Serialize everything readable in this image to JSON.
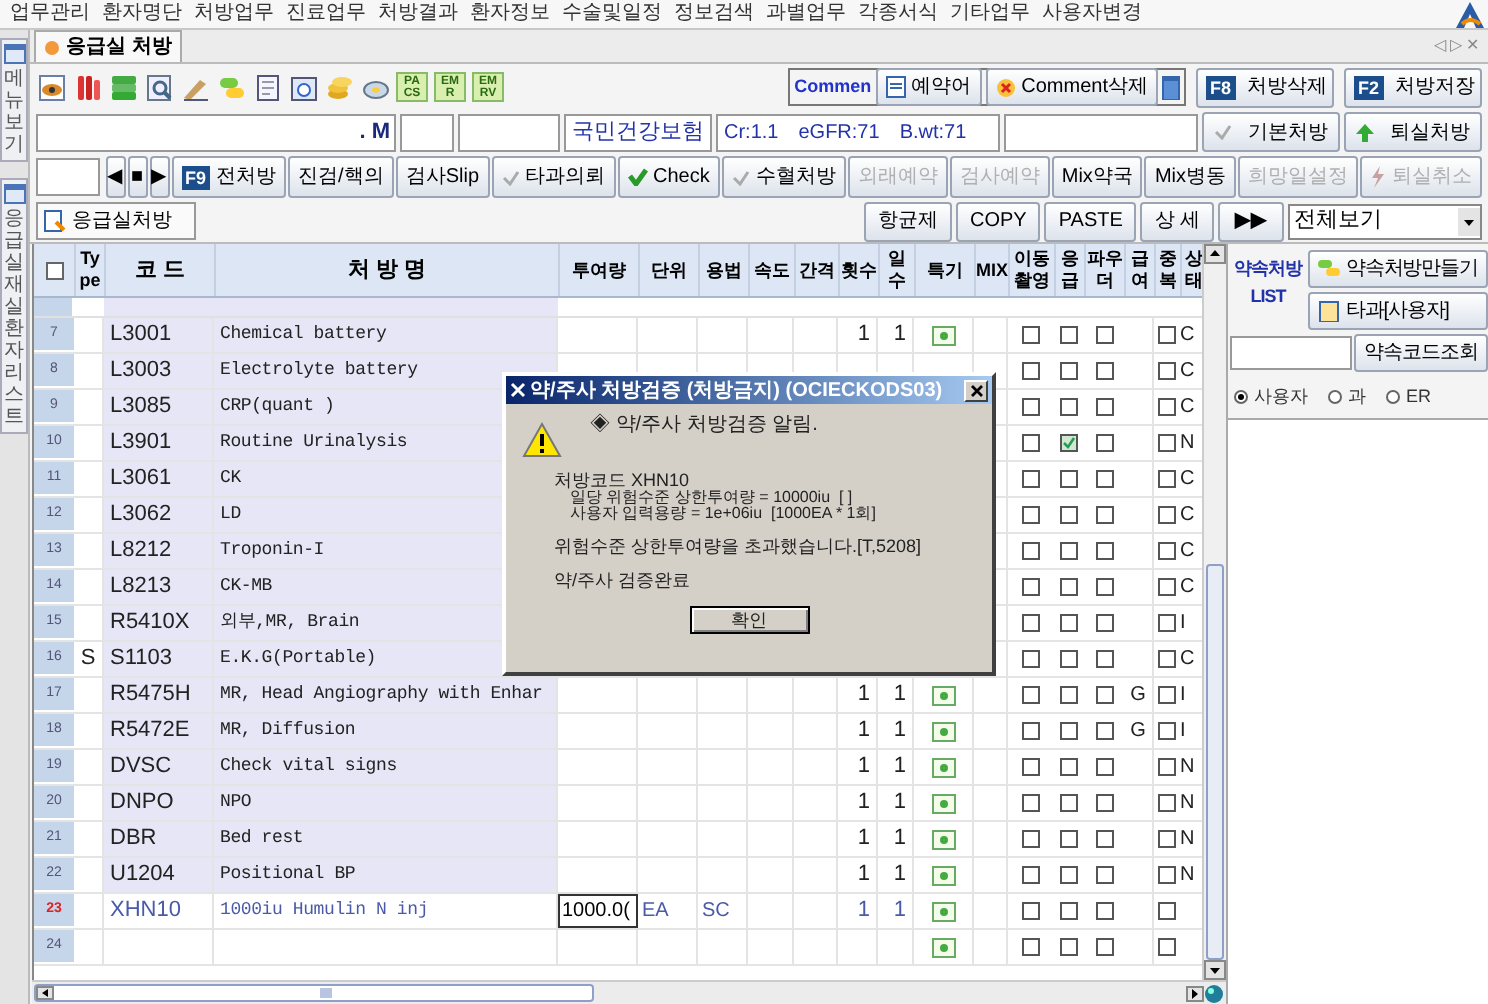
{
  "menu": [
    "업무관리",
    "환자명단",
    "처방업무",
    "진료업무",
    "처방결과",
    "환자정보",
    "수술및일정",
    "정보검색",
    "과별업무",
    "각종서식",
    "기타업무",
    "사용자변경"
  ],
  "side_tabs": [
    {
      "label": "메뉴보기"
    },
    {
      "label": "응급실재실환자리스트"
    }
  ],
  "window_tab": {
    "title": "응급실 처방"
  },
  "window_controls": [
    "◁",
    "▷",
    "✕"
  ],
  "toolbar_icons": [
    {
      "kind": "eye"
    },
    {
      "kind": "tubes"
    },
    {
      "kind": "stack"
    },
    {
      "kind": "magnifier"
    },
    {
      "kind": "pen"
    },
    {
      "kind": "pills"
    },
    {
      "kind": "page"
    },
    {
      "kind": "calendar"
    },
    {
      "kind": "coins"
    },
    {
      "kind": "disc"
    },
    {
      "kind": "text",
      "label": "PACS"
    },
    {
      "kind": "text",
      "label": "EMR"
    },
    {
      "kind": "text",
      "label": "EMRV"
    }
  ],
  "comment": {
    "label": "Commen",
    "buttons": [
      {
        "label": "예약어",
        "kind": "doc"
      },
      {
        "label": "Comment삭제",
        "kind": "delete"
      }
    ]
  },
  "top_actions": [
    {
      "key": "F8",
      "label": "처방삭제"
    },
    {
      "key": "F2",
      "label": "처방저장"
    }
  ],
  "patient": {
    "name": ". M",
    "insurance": "국민건강보험",
    "cr": "Cr:1.1",
    "egfr": "eGFR:71",
    "bwt": "B.wt:71"
  },
  "patient_buttons": [
    {
      "label": "기본처방",
      "kind": "check"
    },
    {
      "label": "퇴실처방",
      "kind": "arrow"
    }
  ],
  "order_buttons": [
    {
      "label": "◀",
      "kind": "nav",
      "disabled": false
    },
    {
      "label": "■",
      "kind": "nav",
      "disabled": false
    },
    {
      "label": "▶",
      "kind": "nav",
      "disabled": false
    },
    {
      "key": "F9",
      "label": "전처방",
      "kind": "key",
      "disabled": false
    },
    {
      "label": "진검/핵의",
      "kind": "plain",
      "disabled": false
    },
    {
      "label": "검사Slip",
      "kind": "plain",
      "disabled": false
    },
    {
      "label": "타과의뢰",
      "kind": "check",
      "disabled": false
    },
    {
      "label": "Check",
      "kind": "check_green",
      "disabled": false
    },
    {
      "label": "수혈처방",
      "kind": "check",
      "disabled": false
    },
    {
      "label": "외래예약",
      "kind": "plain",
      "disabled": true
    },
    {
      "label": "검사예약",
      "kind": "plain",
      "disabled": true
    },
    {
      "label": "Mix약국",
      "kind": "plain",
      "disabled": false
    },
    {
      "label": "Mix병동",
      "kind": "plain",
      "disabled": false
    },
    {
      "label": "희망일설정",
      "kind": "plain",
      "disabled": true
    },
    {
      "label": "퇴실취소",
      "kind": "bolt",
      "disabled": true
    }
  ],
  "order_tab": {
    "label": "응급실처방",
    "selected": true
  },
  "list_buttons": [
    "항균제",
    "COPY",
    "PASTE",
    "상 세",
    "▶▶"
  ],
  "view_select": "전체보기",
  "select_all_checked": false,
  "columns": [
    "Type",
    "코 드",
    "처 방 명",
    "투여량",
    "단위",
    "용법",
    "속도",
    "간격",
    "횟수",
    "일수",
    "특기",
    "MIX",
    "이동촬영",
    "응급",
    "파우더",
    "급여",
    "중복",
    "상태"
  ],
  "rows": [
    {
      "num": "7",
      "code": "L3001",
      "name": "Chemical battery",
      "count": "1",
      "days": "1",
      "note": true,
      "portable": false,
      "emergency": false,
      "powder": false,
      "duplicate": false,
      "status": "C",
      "selected": false
    },
    {
      "num": "8",
      "code": "L3003",
      "name": "Electrolyte battery",
      "note": false,
      "portable": false,
      "emergency": false,
      "powder": false,
      "duplicate": false,
      "status": "C",
      "selected": false
    },
    {
      "num": "9",
      "code": "L3085",
      "name": "CRP(quant )",
      "note": false,
      "portable": false,
      "emergency": false,
      "powder": false,
      "duplicate": false,
      "status": "C",
      "selected": false
    },
    {
      "num": "10",
      "code": "L3901",
      "name": "Routine Urinalysis",
      "note": false,
      "portable": false,
      "emergency": true,
      "powder": false,
      "duplicate": false,
      "status": "N",
      "selected": false
    },
    {
      "num": "11",
      "code": "L3061",
      "name": "CK",
      "note": false,
      "portable": false,
      "emergency": false,
      "powder": false,
      "duplicate": false,
      "status": "C",
      "selected": false
    },
    {
      "num": "12",
      "code": "L3062",
      "name": "LD",
      "note": false,
      "portable": false,
      "emergency": false,
      "powder": false,
      "duplicate": false,
      "status": "C",
      "selected": false
    },
    {
      "num": "13",
      "code": "L8212",
      "name": "Troponin-I",
      "note": false,
      "portable": false,
      "emergency": false,
      "powder": false,
      "duplicate": false,
      "status": "C",
      "selected": false
    },
    {
      "num": "14",
      "code": "L8213",
      "name": "CK-MB",
      "note": false,
      "portable": false,
      "emergency": false,
      "powder": false,
      "duplicate": false,
      "status": "C",
      "selected": false
    },
    {
      "num": "15",
      "code": "R5410X",
      "name": "외부,MR, Brain",
      "note": false,
      "portable": false,
      "emergency": false,
      "powder": false,
      "duplicate": false,
      "status": "I",
      "selected": false
    },
    {
      "num": "16",
      "type": "S",
      "code": "S1103",
      "name": "E.K.G(Portable)",
      "note": false,
      "portable": false,
      "emergency": false,
      "powder": false,
      "duplicate": false,
      "status": "C",
      "selected": false
    },
    {
      "num": "17",
      "code": "R5475H",
      "name": "MR, Head Angiography with Enhar",
      "count": "1",
      "days": "1",
      "note": true,
      "portable": false,
      "emergency": false,
      "powder": false,
      "pay": "G",
      "duplicate": false,
      "status": "I",
      "selected": false
    },
    {
      "num": "18",
      "code": "R5472E",
      "name": "MR, Diffusion",
      "count": "1",
      "days": "1",
      "note": true,
      "portable": false,
      "emergency": false,
      "powder": false,
      "pay": "G",
      "duplicate": false,
      "status": "I",
      "selected": false
    },
    {
      "num": "19",
      "code": "DVSC",
      "name": "Check vital signs",
      "count": "1",
      "days": "1",
      "note": true,
      "portable": false,
      "emergency": false,
      "powder": false,
      "duplicate": false,
      "status": "N",
      "selected": false
    },
    {
      "num": "20",
      "code": "DNPO",
      "name": "NPO",
      "count": "1",
      "days": "1",
      "note": true,
      "portable": false,
      "emergency": false,
      "powder": false,
      "duplicate": false,
      "status": "N",
      "selected": false
    },
    {
      "num": "21",
      "code": "DBR",
      "name": "Bed rest",
      "count": "1",
      "days": "1",
      "note": true,
      "portable": false,
      "emergency": false,
      "powder": false,
      "duplicate": false,
      "status": "N",
      "selected": false
    },
    {
      "num": "22",
      "code": "U1204",
      "name": "Positional BP",
      "count": "1",
      "days": "1",
      "note": true,
      "portable": false,
      "emergency": false,
      "powder": false,
      "duplicate": false,
      "status": "N",
      "selected": false
    },
    {
      "num": "23",
      "code": "XHN10",
      "name": "1000iu Humulin N inj",
      "dose": "1000.0(",
      "unit": "EA",
      "route": "SC",
      "count": "1",
      "days": "1",
      "note": true,
      "portable": false,
      "emergency": false,
      "powder": false,
      "duplicate": false,
      "selected": true
    },
    {
      "num": "24",
      "note": true,
      "portable": false,
      "emergency": false,
      "powder": false,
      "duplicate": false,
      "selected": false
    }
  ],
  "right_panel": {
    "title": "약속처방 LIST",
    "buttons": [
      "약속처방만들기",
      "타과[사용자]"
    ],
    "search_button": "약속코드조회",
    "radios": [
      {
        "label": "사용자",
        "selected": true
      },
      {
        "label": "과",
        "selected": false
      },
      {
        "label": "ER",
        "selected": false
      }
    ]
  },
  "dialog": {
    "title": "약/주사 처방검증 (처방금지) (OCIECKODS03)",
    "heading": "◈ 약/주사 처방검증 알림.",
    "lines": [
      "처방코드 XHN10",
      "일당 위험수준 상한투여량 = 10000iu  [ ]",
      "사용자 입력용량 = 1e+06iu  [1000EA * 1회]"
    ],
    "message": "위험수준 상한투여량을 초과했습니다.[T,5208]",
    "result": "약/주사 검증완료",
    "button": "확인"
  }
}
